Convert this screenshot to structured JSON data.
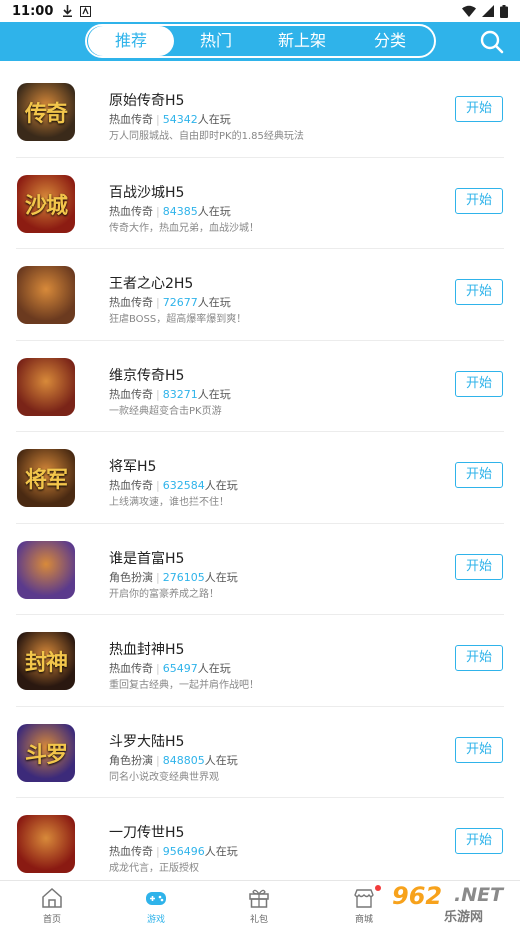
{
  "status_bar": {
    "time": "11:00"
  },
  "header": {
    "tabs": [
      {
        "label": "推荐",
        "active": true
      },
      {
        "label": "热门",
        "active": false
      },
      {
        "label": "新上架",
        "active": false
      },
      {
        "label": "分类",
        "active": false
      }
    ],
    "accent_color": "#2fb3ea"
  },
  "games": [
    {
      "name": "原始传奇H5",
      "category": "热血传奇",
      "players": "54342",
      "players_suffix": "人在玩",
      "desc": "万人同服城战、自由即时PK的1.85经典玩法",
      "button": "开始",
      "icon_text": "传奇",
      "icon_bg": "#3a2a1a"
    },
    {
      "name": "百战沙城H5",
      "category": "热血传奇",
      "players": "84385",
      "players_suffix": "人在玩",
      "desc": "传奇大作，热血兄弟，血战沙城！",
      "button": "开始",
      "icon_text": "沙城",
      "icon_bg": "#8c1c12"
    },
    {
      "name": "王者之心2H5",
      "category": "热血传奇",
      "players": "72677",
      "players_suffix": "人在玩",
      "desc": "狂虐BOSS，超高爆率爆到爽！",
      "button": "开始",
      "icon_text": "",
      "icon_bg": "#6b3a1f"
    },
    {
      "name": "维京传奇H5",
      "category": "热血传奇",
      "players": "83271",
      "players_suffix": "人在玩",
      "desc": "一款经典超变合击PK页游",
      "button": "开始",
      "icon_text": "",
      "icon_bg": "#7a2418"
    },
    {
      "name": "将军H5",
      "category": "热血传奇",
      "players": "632584",
      "players_suffix": "人在玩",
      "desc": "上线满攻速，谁也拦不住！",
      "button": "开始",
      "icon_text": "将军",
      "icon_bg": "#4a2a12"
    },
    {
      "name": "谁是首富H5",
      "category": "角色扮演",
      "players": "276105",
      "players_suffix": "人在玩",
      "desc": "开启你的富豪养成之路！",
      "button": "开始",
      "icon_text": "",
      "icon_bg": "#5b3a8c"
    },
    {
      "name": "热血封神H5",
      "category": "热血传奇",
      "players": "65497",
      "players_suffix": "人在玩",
      "desc": "重回复古经典，一起并肩作战吧！",
      "button": "开始",
      "icon_text": "封神",
      "icon_bg": "#2a1810"
    },
    {
      "name": "斗罗大陆H5",
      "category": "角色扮演",
      "players": "848805",
      "players_suffix": "人在玩",
      "desc": "同名小说改变经典世界观",
      "button": "开始",
      "icon_text": "斗罗",
      "icon_bg": "#3c2a7a"
    },
    {
      "name": "一刀传世H5",
      "category": "热血传奇",
      "players": "956496",
      "players_suffix": "人在玩",
      "desc": "成龙代言，正版授权",
      "button": "开始",
      "icon_text": "",
      "icon_bg": "#8a1a12"
    }
  ],
  "bottom_nav": [
    {
      "label": "首页",
      "icon": "home-icon",
      "active": false
    },
    {
      "label": "游戏",
      "icon": "gamepad-icon",
      "active": true
    },
    {
      "label": "礼包",
      "icon": "gift-icon",
      "active": false
    },
    {
      "label": "商城",
      "icon": "store-icon",
      "active": false
    }
  ],
  "watermark": {
    "main": "962",
    "net": ".NET",
    "sub": "乐游网"
  }
}
